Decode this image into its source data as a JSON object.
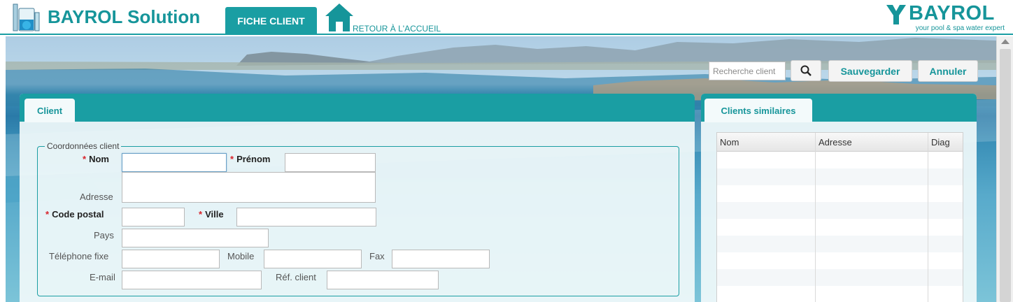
{
  "header": {
    "app_title": "BAYROL Solution",
    "active_tab": "FICHE CLIENT",
    "home_label": "RETOUR À L'ACCUEIL",
    "brand_name": "BAYROL",
    "brand_tagline": "your pool & spa water expert",
    "icons": [
      "app-logo-icon",
      "home-icon",
      "bayrol-y-icon"
    ]
  },
  "toolbar": {
    "search_placeholder": "Recherche client",
    "search_value": "",
    "save_label": "Sauvegarder",
    "cancel_label": "Annuler",
    "search_icon": "search-icon"
  },
  "client_panel": {
    "tab_label": "Client",
    "fieldset_legend": "Coordonnées client",
    "required_marker": "*",
    "fields": {
      "nom": {
        "label": "Nom",
        "value": "",
        "required": true
      },
      "prenom": {
        "label": "Prénom",
        "value": "",
        "required": true
      },
      "adresse": {
        "label": "Adresse",
        "value": ""
      },
      "code_postal": {
        "label": "Code postal",
        "value": "",
        "required": true
      },
      "ville": {
        "label": "Ville",
        "value": "",
        "required": true
      },
      "pays": {
        "label": "Pays",
        "value": ""
      },
      "telephone_fixe": {
        "label": "Téléphone fixe",
        "value": ""
      },
      "mobile": {
        "label": "Mobile",
        "value": ""
      },
      "fax": {
        "label": "Fax",
        "value": ""
      },
      "email": {
        "label": "E-mail",
        "value": ""
      },
      "ref_client": {
        "label": "Réf. client",
        "value": ""
      }
    }
  },
  "similar_panel": {
    "tab_label": "Clients similaires",
    "columns": [
      "Nom",
      "Adresse",
      "Diag"
    ],
    "rows": []
  },
  "colors": {
    "accent": "#1a9ea3",
    "required": "#d8232a"
  }
}
